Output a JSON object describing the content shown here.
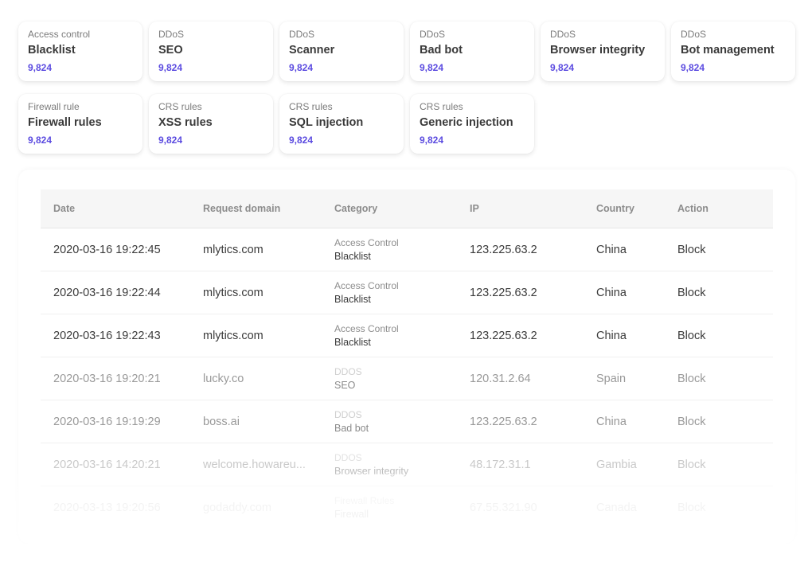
{
  "cards": [
    {
      "category": "Access control",
      "title": "Blacklist",
      "count": "9,824"
    },
    {
      "category": "DDoS",
      "title": "SEO",
      "count": "9,824"
    },
    {
      "category": "DDoS",
      "title": "Scanner",
      "count": "9,824"
    },
    {
      "category": "DDoS",
      "title": "Bad bot",
      "count": "9,824"
    },
    {
      "category": "DDoS",
      "title": "Browser integrity",
      "count": "9,824"
    },
    {
      "category": "DDoS",
      "title": "Bot management",
      "count": "9,824"
    },
    {
      "category": "Firewall rule",
      "title": "Firewall rules",
      "count": "9,824"
    },
    {
      "category": "CRS rules",
      "title": "XSS rules",
      "count": "9,824"
    },
    {
      "category": "CRS rules",
      "title": "SQL injection",
      "count": "9,824"
    },
    {
      "category": "CRS rules",
      "title": "Generic injection",
      "count": "9,824"
    }
  ],
  "table": {
    "columns": [
      "Date",
      "Request domain",
      "Category",
      "IP",
      "Country",
      "Action"
    ],
    "rows": [
      {
        "date": "2020-03-16 19:22:45",
        "domain": "mlytics.com",
        "category": "Access Control",
        "subcategory": "Blacklist",
        "ip": "123.225.63.2",
        "country": "China",
        "action": "Block"
      },
      {
        "date": "2020-03-16 19:22:44",
        "domain": "mlytics.com",
        "category": "Access Control",
        "subcategory": "Blacklist",
        "ip": "123.225.63.2",
        "country": "China",
        "action": "Block"
      },
      {
        "date": "2020-03-16 19:22:43",
        "domain": "mlytics.com",
        "category": "Access Control",
        "subcategory": "Blacklist",
        "ip": "123.225.63.2",
        "country": "China",
        "action": "Block"
      },
      {
        "date": "2020-03-16 19:20:21",
        "domain": "lucky.co",
        "category": "DDOS",
        "subcategory": "SEO",
        "ip": "120.31.2.64",
        "country": "Spain",
        "action": "Block"
      },
      {
        "date": "2020-03-16 19:19:29",
        "domain": "boss.ai",
        "category": "DDOS",
        "subcategory": "Bad bot",
        "ip": "123.225.63.2",
        "country": "China",
        "action": "Block"
      },
      {
        "date": "2020-03-16 14:20:21",
        "domain": "welcome.howareu...",
        "category": "DDOS",
        "subcategory": "Browser integrity",
        "ip": "48.172.31.1",
        "country": "Gambia",
        "action": "Block"
      },
      {
        "date": "2020-03-13 19:20:56",
        "domain": "godaddy.com",
        "category": "Firewall Rules",
        "subcategory": "Firewall",
        "ip": "67.55.321.90",
        "country": "Canada",
        "action": "Block"
      }
    ]
  }
}
